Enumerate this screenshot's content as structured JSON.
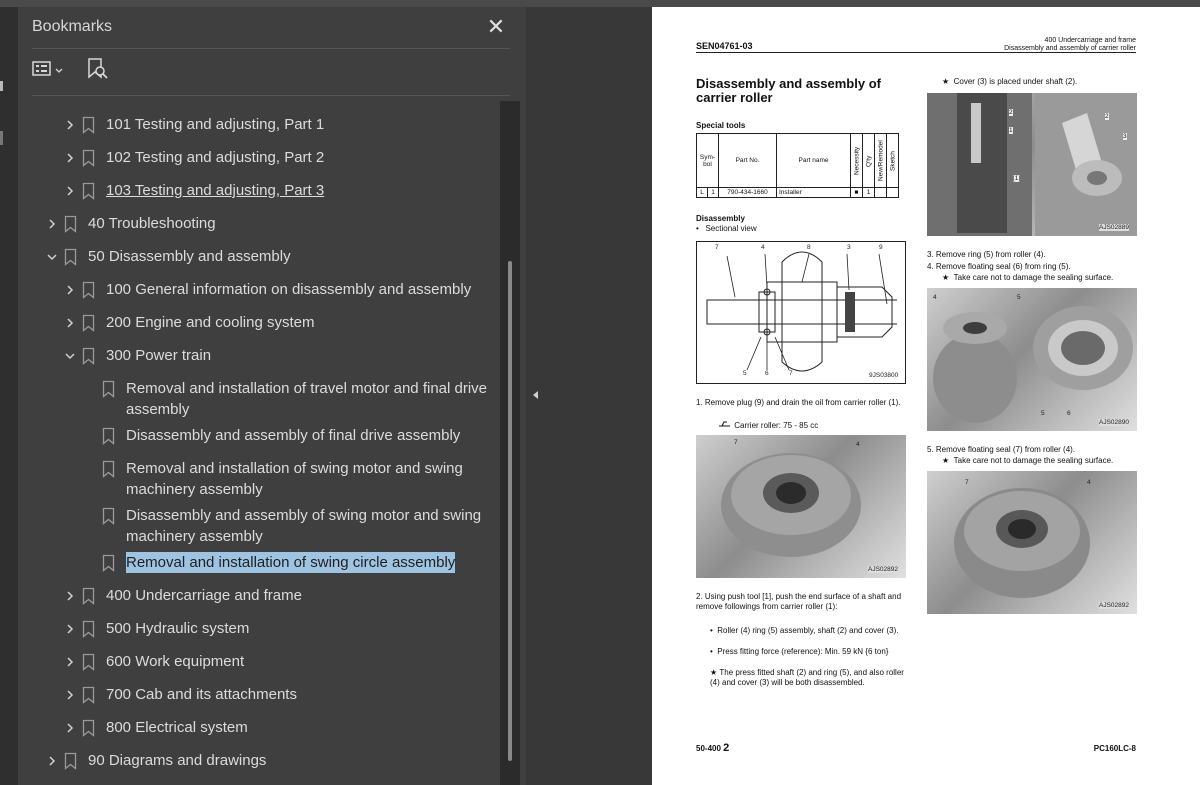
{
  "bookmarks_panel": {
    "title": "Bookmarks",
    "close_glyph": "✕",
    "options_icon": "list-options-icon",
    "find_icon": "find-bookmark-icon",
    "items": [
      {
        "label": "101 Testing and adjusting, Part 1",
        "expand": "collapsed",
        "level": 2
      },
      {
        "label": "102 Testing and adjusting, Part 2",
        "expand": "collapsed",
        "level": 2
      },
      {
        "label": "103 Testing and adjusting, Part 3",
        "expand": "collapsed",
        "level": 2
      },
      {
        "label": "40 Troubleshooting",
        "expand": "collapsed",
        "level": 1
      },
      {
        "label": "50 Disassembly and assembly",
        "expand": "expanded",
        "level": 1
      },
      {
        "label": "100 General information on disassembly and assembly",
        "expand": "collapsed",
        "level": 2
      },
      {
        "label": "200 Engine and cooling system",
        "expand": "collapsed",
        "level": 2
      },
      {
        "label": "300 Power train",
        "expand": "expanded",
        "level": 2
      },
      {
        "label": "Removal and installation of travel motor and final drive assembly",
        "expand": "none",
        "level": 3
      },
      {
        "label": "Disassembly and assembly of final drive assembly",
        "expand": "none",
        "level": 3
      },
      {
        "label": "Removal and installation of swing motor and swing machinery assembly",
        "expand": "none",
        "level": 3
      },
      {
        "label": "Disassembly and assembly of swing motor and swing machinery assembly",
        "expand": "none",
        "level": 3
      },
      {
        "label": "Removal and installation of swing circle assembly",
        "expand": "none",
        "level": 3,
        "selected": true
      },
      {
        "label": "400 Undercarriage and frame",
        "expand": "collapsed",
        "level": 2
      },
      {
        "label": "500 Hydraulic system",
        "expand": "collapsed",
        "level": 2
      },
      {
        "label": "600 Work equipment",
        "expand": "collapsed",
        "level": 2
      },
      {
        "label": "700 Cab and its attachments",
        "expand": "collapsed",
        "level": 2
      },
      {
        "label": "800 Electrical system",
        "expand": "collapsed",
        "level": 2
      },
      {
        "label": "90 Diagrams and drawings",
        "expand": "collapsed",
        "level": 1
      }
    ]
  },
  "document": {
    "doc_id": "SEN04761-03",
    "header_right_1": "400 Undercarriage and frame",
    "header_right_2": "Disassembly and assembly of carrier roller",
    "title": "Disassembly and assembly of carrier roller",
    "special_tools": "Special tools",
    "tools_head_symbol": "Sym-bol",
    "tools_head_partno": "Part No.",
    "tools_head_partname": "Part name",
    "tools_head_necessity": "Necessity",
    "tools_head_qty": "Q'ty",
    "tools_head_newremodel": "New/Remodel",
    "tools_head_sketch": "Sketch",
    "tool_sym": "L",
    "tool_num": "1",
    "tool_partno": "790-434-1660",
    "tool_partname": "Installer",
    "tool_necessity": "■",
    "tool_qty": "1",
    "disassembly": "Disassembly",
    "sectional_view": "Sectional view",
    "section_code": "9JS03800",
    "step1": "1.  Remove plug (9) and drain the oil from carrier roller (1).",
    "step1_sub": "Carrier roller: 75 - 85 cc",
    "photo1_code": "AJS02892",
    "step2": "2.  Using push tool [1], push the end surface of a shaft and remove followings from carrier roller (1):",
    "step2_b1": "Roller (4) ring (5) assembly, shaft (2) and cover (3).",
    "step2_b2": "Press fitting force (reference): Min. 59 kN {6 ton}",
    "step2_b3": "The press fitted shaft (2) and ring (5), and also roller (4) and cover (3) will be both disassembled.",
    "right_note": "Cover (3) is placed under shaft (2).",
    "photo_top_code": "AJS02889",
    "step3": "3.  Remove ring (5) from roller (4).",
    "step4": "4.  Remove floating seal (6) from ring (5).",
    "step4_sub": "Take care not to damage the sealing surface.",
    "photo_mid_code": "AJS02890",
    "step5": "5.  Remove floating seal (7) from roller (4).",
    "step5_sub": "Take care not to damage the sealing surface.",
    "photo_bot_code": "AJS02892",
    "footer_left": "50-400",
    "footer_page": "2",
    "footer_right": "PC160LC-8",
    "labels": {
      "n1": "1",
      "n2": "2",
      "n3": "3",
      "n4": "4",
      "n5": "5",
      "n6": "6",
      "n7": "7",
      "n8": "8",
      "n9": "9",
      "b1": "[1]"
    }
  }
}
